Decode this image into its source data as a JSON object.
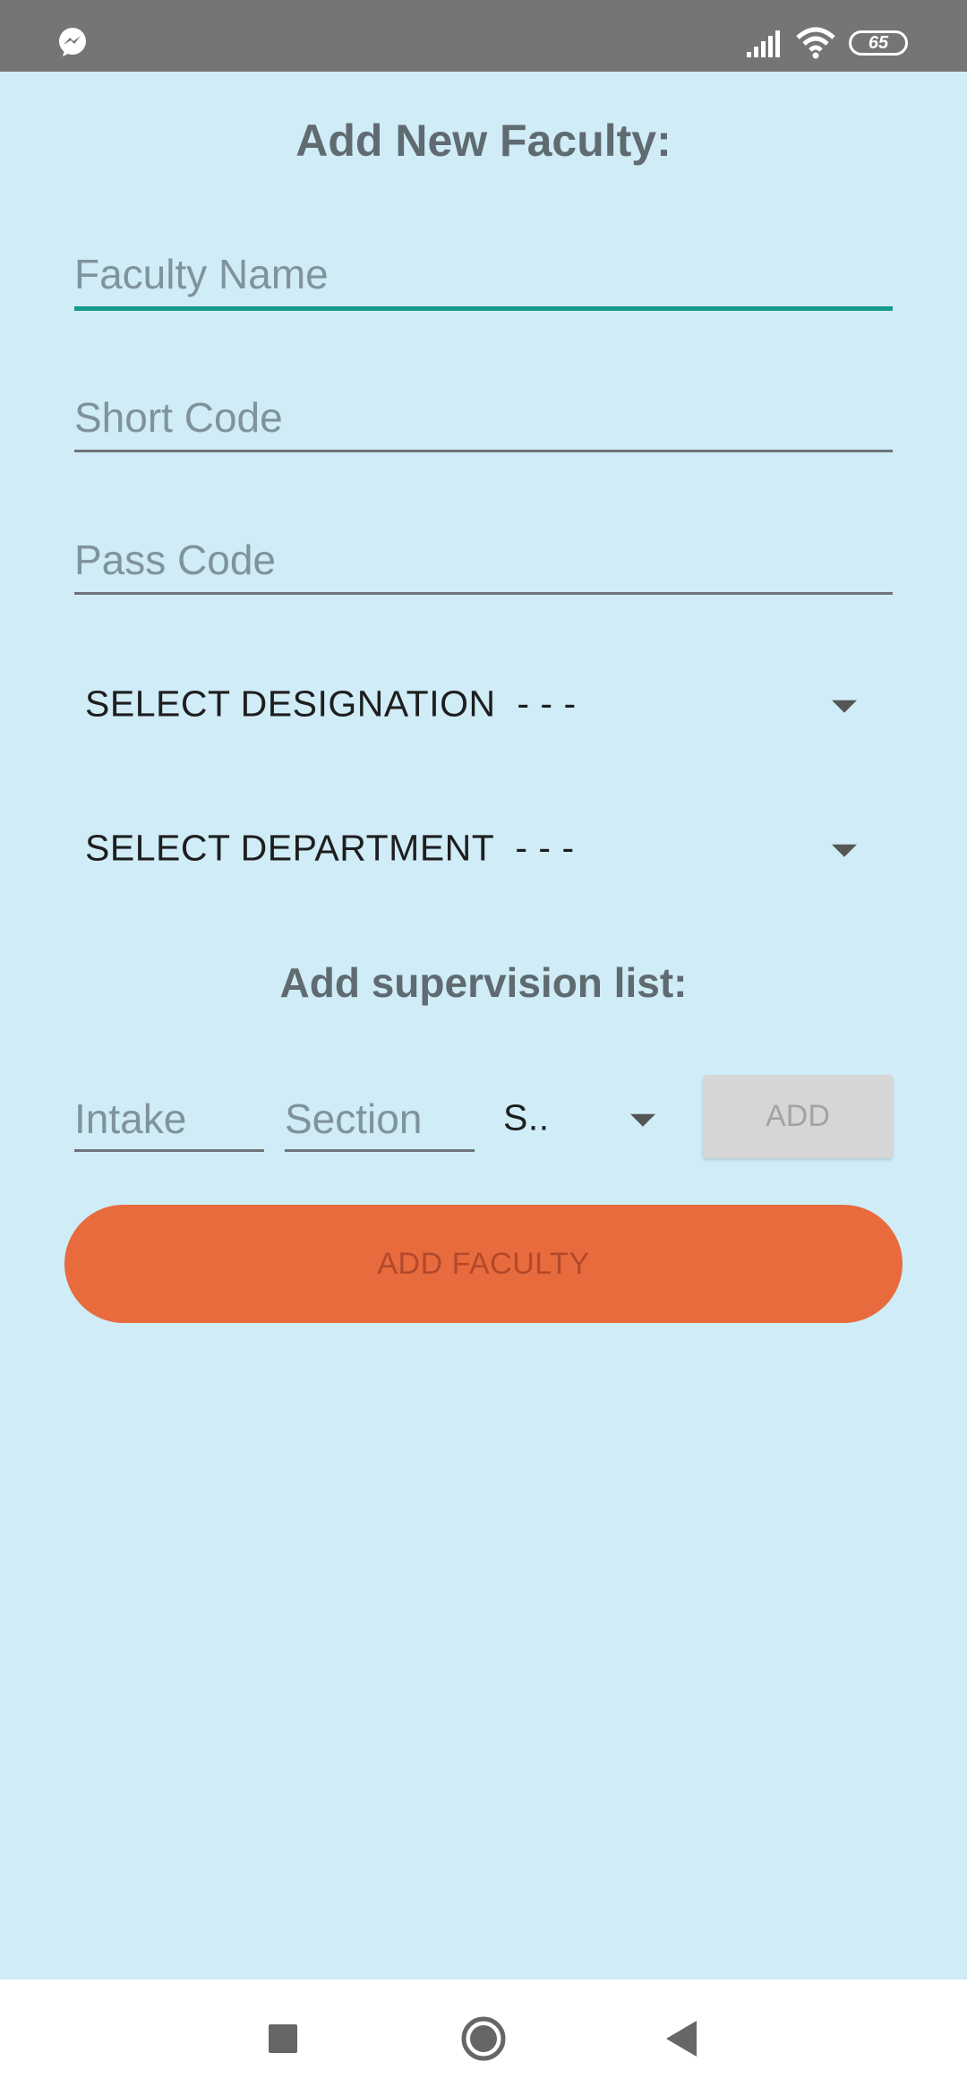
{
  "status_bar": {
    "battery_level": "65",
    "icons": [
      "messenger-icon",
      "signal-icon",
      "wifi-icon",
      "battery-icon"
    ]
  },
  "form": {
    "title": "Add New Faculty:",
    "faculty_name": {
      "placeholder": "Faculty Name",
      "value": ""
    },
    "short_code": {
      "placeholder": "Short Code",
      "value": ""
    },
    "pass_code": {
      "placeholder": "Pass Code",
      "value": ""
    },
    "designation": {
      "label": "SELECT DESIGNATION  - - -"
    },
    "department": {
      "label": "SELECT DEPARTMENT  - - -"
    }
  },
  "supervision": {
    "title": "Add supervision list:",
    "intake": {
      "placeholder": "Intake",
      "value": ""
    },
    "section": {
      "placeholder": "Section",
      "value": ""
    },
    "semester_spinner": {
      "label": "S.."
    },
    "add_label": "ADD"
  },
  "submit_label": "ADD FACULTY",
  "nav": {
    "icons": [
      "recents-icon",
      "home-icon",
      "back-icon"
    ]
  },
  "colors": {
    "background": "#CFECF7",
    "status_bar": "#757575",
    "accent_focus": "#159A8C",
    "submit_button": "#E86B3E",
    "disabled_button": "#D6D6D6"
  }
}
